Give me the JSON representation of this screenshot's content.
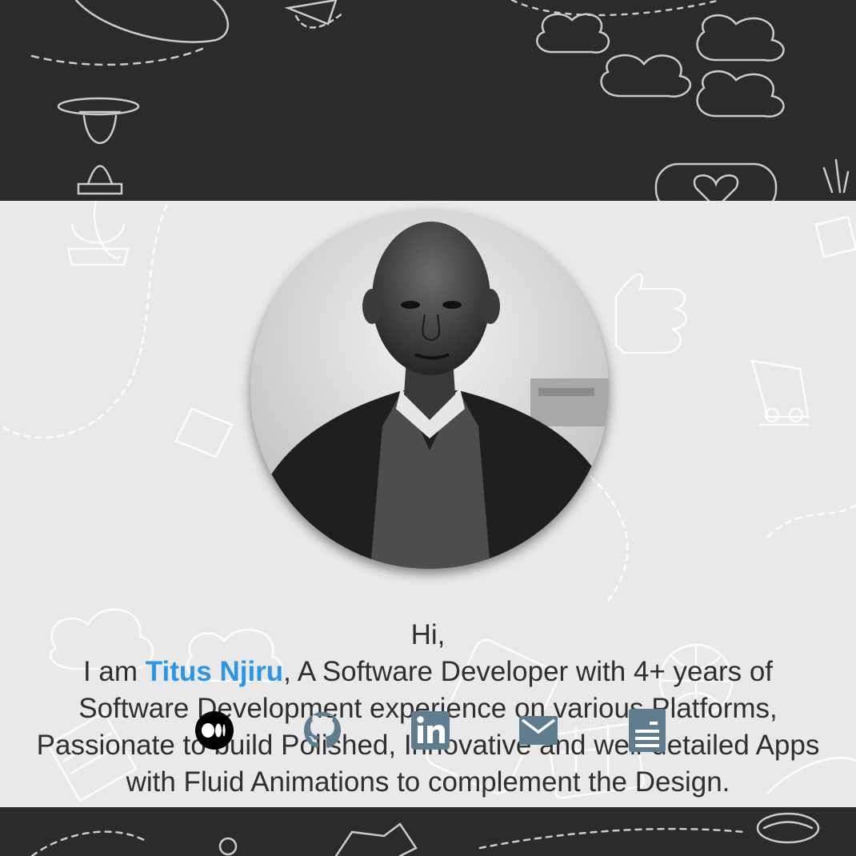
{
  "profile": {
    "greeting": "Hi,",
    "intro_prefix": "I am ",
    "name": "Titus Njiru",
    "intro_suffix": ", A Software Developer with 4+ years of Software Development experience on various Platforms, Passionate to build Polished, Innovative and well-detailed Apps with Fluid Animations to complement the Design."
  },
  "social_links": [
    {
      "name": "medium",
      "icon": "medium-icon"
    },
    {
      "name": "github",
      "icon": "github-icon"
    },
    {
      "name": "linkedin",
      "icon": "linkedin-icon"
    },
    {
      "name": "email",
      "icon": "mail-icon"
    },
    {
      "name": "resume",
      "icon": "document-icon"
    }
  ],
  "colors": {
    "accent": "#2b95e9",
    "icon": "#5f7d8e",
    "background_dark": "#2b2b2b",
    "card": "#e9e9e9",
    "text": "#2f2f2f"
  }
}
